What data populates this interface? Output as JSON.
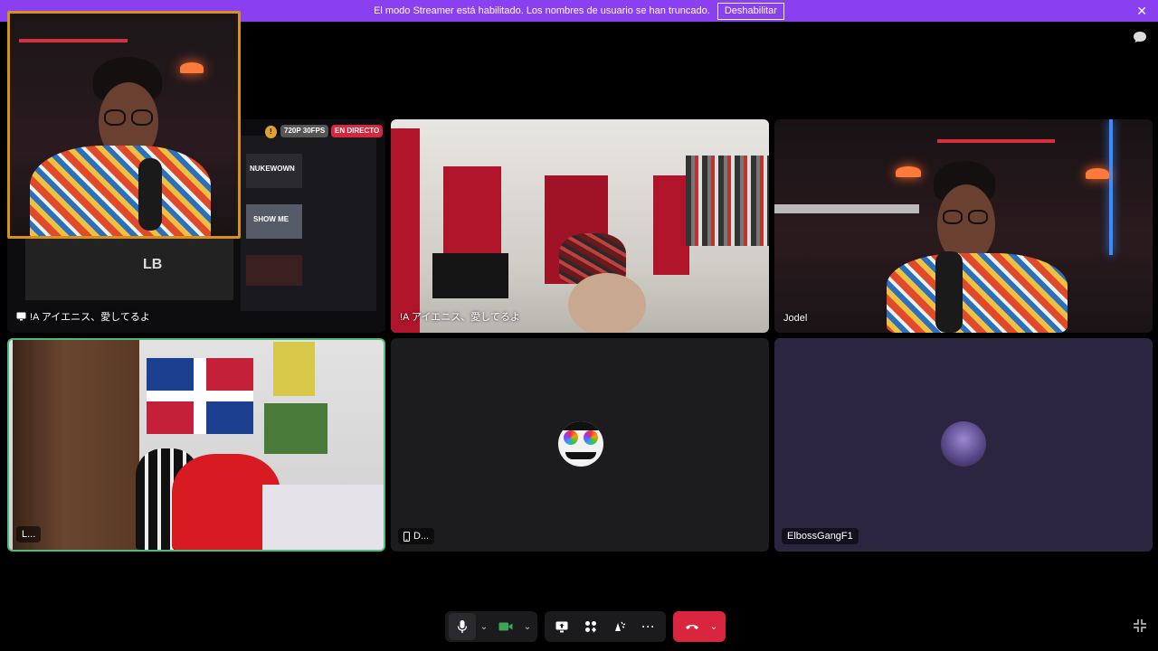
{
  "banner": {
    "message": "El modo Streamer está habilitado. Los nombres de usuario se han truncado.",
    "disable_label": "Deshabilitar",
    "close_glyph": "✕",
    "color": "#8a3ff0"
  },
  "stream_badges": {
    "warning_glyph": "!",
    "quality": "720P 30FPS",
    "live": "EN DIRECTO"
  },
  "stream_overlay": {
    "thumb1": "NUKEWOWN",
    "thumb2": "SHOW ME",
    "logo_text": "LB"
  },
  "tiles": [
    {
      "label": "!A アイエニス、愛してるよ",
      "icon": "screen-share-icon"
    },
    {
      "label": "!A アイエニス、愛してるよ"
    },
    {
      "label": "Jodel"
    },
    {
      "label": "L..."
    },
    {
      "label": "D...",
      "icon": "mobile-phone-icon"
    },
    {
      "label": "ElbossGangF1"
    }
  ],
  "controls": {
    "chevron_glyph": "⌄",
    "more_glyph": "···",
    "hangup_color": "#d7263d"
  },
  "icons": [
    "chat-bubble-icon",
    "microphone-icon",
    "camera-icon",
    "screen-share-icon",
    "activities-icon",
    "soundboard-icon",
    "more-icon",
    "hang-up-icon",
    "collapse-icon",
    "close-icon"
  ]
}
